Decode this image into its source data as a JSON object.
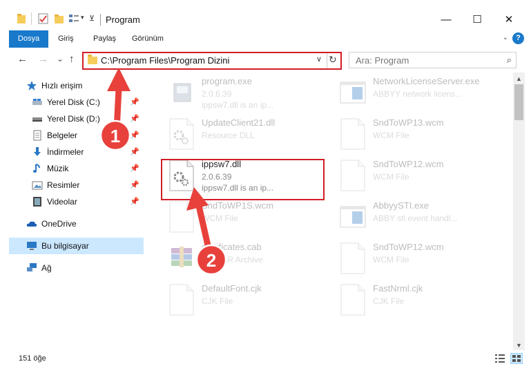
{
  "window": {
    "title": "Program",
    "minimize": "—",
    "maximize": "☐",
    "close": "✕"
  },
  "ribbon": {
    "tabs": [
      "Dosya",
      "Giriş",
      "Paylaş",
      "Görünüm"
    ],
    "help": "?"
  },
  "nav": {
    "back": "←",
    "forward": "→",
    "recent": "⌄",
    "up": "↑",
    "address": "C:\\Program Files\\Program Dizini",
    "search_placeholder": "Ara: Program"
  },
  "sidebar": {
    "items": [
      {
        "label": "Hızlı erişim",
        "icon": "star-icon"
      },
      {
        "label": "Yerel Disk (C:)",
        "icon": "drive-icon",
        "pinned": true
      },
      {
        "label": "Yerel Disk (D:)",
        "icon": "drive-icon",
        "pinned": true
      },
      {
        "label": "Belgeler",
        "icon": "documents-icon",
        "pinned": true
      },
      {
        "label": "İndirmeler",
        "icon": "download-icon",
        "pinned": true
      },
      {
        "label": "Müzik",
        "icon": "music-icon",
        "pinned": true
      },
      {
        "label": "Resimler",
        "icon": "pictures-icon",
        "pinned": true
      },
      {
        "label": "Videolar",
        "icon": "video-icon",
        "pinned": true
      },
      {
        "label": "OneDrive",
        "icon": "cloud-icon"
      },
      {
        "label": "Bu bilgisayar",
        "icon": "computer-icon",
        "selected": true
      },
      {
        "label": "Ağ",
        "icon": "network-icon"
      }
    ]
  },
  "files": {
    "left": [
      {
        "name": "program.exe",
        "line1": "2.0.6.39",
        "line2": "ippsw7.dll is an ip...",
        "icon": "program-exe-icon",
        "dim": true
      },
      {
        "name": "UpdateClient21.dll",
        "line1": "Resource DLL",
        "line2": "",
        "icon": "dll-icon",
        "dim": true
      },
      {
        "name": "ippsw7.dll",
        "line1": "2.0.6.39",
        "line2": "ippsw7.dll is an ip...",
        "icon": "dll-icon",
        "dim": false,
        "highlighted": true
      },
      {
        "name": "SndToWP1S.wcm",
        "line1": "WCM File",
        "line2": "",
        "icon": "file-icon",
        "dim": true
      },
      {
        "name": "certificates.cab",
        "line1": "WinRAR Archive",
        "line2": "",
        "icon": "winrar-icon",
        "dim": true
      },
      {
        "name": "DefaultFont.cjk",
        "line1": "CJK File",
        "line2": "",
        "icon": "file-icon",
        "dim": true
      }
    ],
    "right": [
      {
        "name": "NetworkLicenseServer.exe",
        "line1": "ABBYY network licens...",
        "line2": "",
        "icon": "app-window-icon",
        "dim": true
      },
      {
        "name": "SndToWP13.wcm",
        "line1": "WCM File",
        "line2": "",
        "icon": "file-icon",
        "dim": true
      },
      {
        "name": "SndToWP12.wcm",
        "line1": "WCM File",
        "line2": "",
        "icon": "file-icon",
        "dim": true
      },
      {
        "name": "AbbyySTI.exe",
        "line1": "ABBY sti event handl...",
        "line2": "",
        "icon": "app-window-icon",
        "dim": true
      },
      {
        "name": "SndToWP12.wcm",
        "line1": "WCM File",
        "line2": "",
        "icon": "file-icon",
        "dim": true
      },
      {
        "name": "FastNrml.cjk",
        "line1": "CJK File",
        "line2": "",
        "icon": "file-icon",
        "dim": true
      }
    ]
  },
  "status": {
    "count": "151 öğe"
  },
  "annotations": {
    "markers": [
      "1",
      "2"
    ],
    "color": "#e8413c"
  }
}
